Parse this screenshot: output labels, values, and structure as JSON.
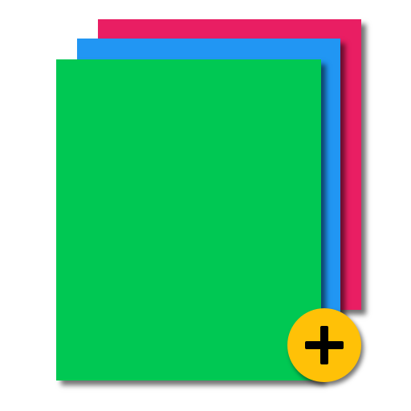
{
  "icon": {
    "name": "new-document-stack-icon",
    "sheets": [
      {
        "name": "back-sheet",
        "color": "#e91e63"
      },
      {
        "name": "middle-sheet",
        "color": "#2196f3"
      },
      {
        "name": "front-sheet",
        "color": "#00c853"
      }
    ],
    "badge": {
      "icon": "plus-icon",
      "color": "#ffc107",
      "symbol_color": "#000000"
    }
  }
}
